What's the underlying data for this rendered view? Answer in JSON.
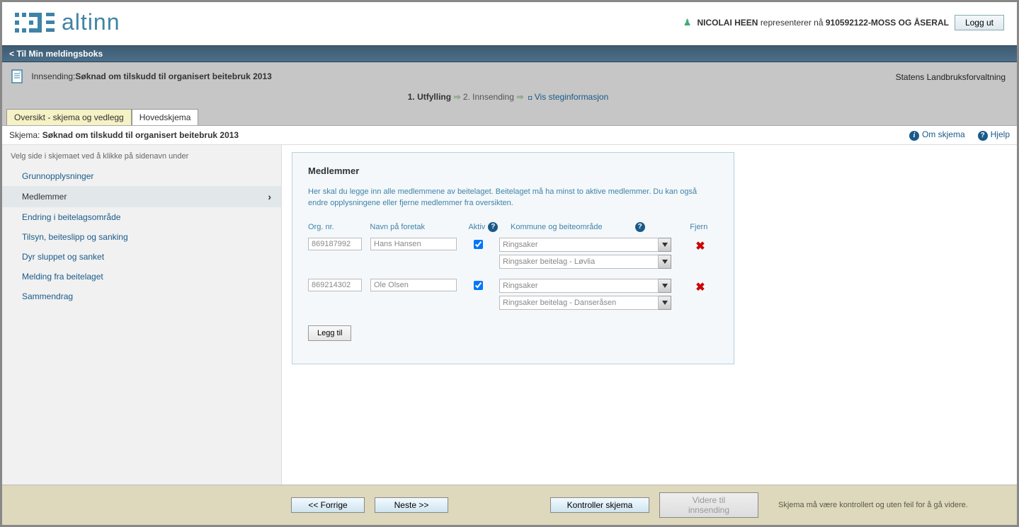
{
  "header": {
    "logo_text": "altinn",
    "user_name": "NICOLAI HEEN",
    "represents_text": "representerer nå",
    "represents_org": "910592122-MOSS OG ÅSERAL",
    "logout": "Logg ut"
  },
  "nav": {
    "back": "< Til Min meldingsboks"
  },
  "sub": {
    "prefix": "Innsending:",
    "title": "Søknad om tilskudd til organisert beitebruk 2013",
    "agency": "Statens Landbruksforvaltning",
    "step1": "1.  Utfylling",
    "step2": "2.  Innsending",
    "show_steps": "Vis steginformasjon"
  },
  "tabs": {
    "overview": "Oversikt - skjema og vedlegg",
    "main": "Hovedskjema"
  },
  "schemarow": {
    "label": "Skjema:",
    "name": "Søknad om tilskudd til organisert beitebruk 2013",
    "about": "Om skjema",
    "help": "Hjelp"
  },
  "sidebar": {
    "hint": "Velg side i skjemaet ved å klikke på sidenavn under",
    "items": [
      {
        "label": "Grunnopplysninger"
      },
      {
        "label": "Medlemmer"
      },
      {
        "label": "Endring i beitelagsområde"
      },
      {
        "label": "Tilsyn, beiteslipp og sanking"
      },
      {
        "label": "Dyr sluppet og sanket"
      },
      {
        "label": "Melding fra beitelaget"
      },
      {
        "label": "Sammendrag"
      }
    ]
  },
  "panel": {
    "title": "Medlemmer",
    "hint": "Her skal du legge inn alle medlemmene av beitelaget. Beitelaget må ha minst to aktive medlemmer. Du kan også endre opplysningene eller fjerne medlemmer fra oversikten.",
    "cols": {
      "org": "Org. nr.",
      "name": "Navn på foretak",
      "aktiv": "Aktiv",
      "kommune": "Kommune og beiteområde",
      "fjern": "Fjern"
    },
    "rows": [
      {
        "org": "869187992",
        "name": "Hans Hansen",
        "aktiv": true,
        "kommune": "Ringsaker",
        "omrade": "Ringsaker beitelag - Løvlia"
      },
      {
        "org": "869214302",
        "name": "Ole Olsen",
        "aktiv": true,
        "kommune": "Ringsaker",
        "omrade": "Ringsaker beitelag - Danseråsen"
      }
    ],
    "add": "Legg til"
  },
  "footer": {
    "prev": "<< Forrige",
    "next": "Neste >>",
    "kontroll": "Kontroller skjema",
    "videre": "Videre til innsending",
    "hint": "Skjema må være kontrollert og uten feil for å gå videre."
  }
}
